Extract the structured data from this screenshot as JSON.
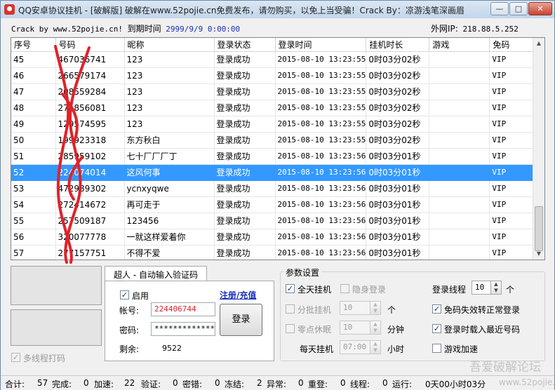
{
  "window": {
    "title": "QQ安卓协议挂机 - [破解版]  破解在www.52pojie.cn免费发布，请勿购买，以免上当受骗！Crack By：凉游浅笔深画眉",
    "controls": {
      "minimize": "—",
      "maximize": "□",
      "close": "✕"
    }
  },
  "info": {
    "crack_by": "Crack by www.52pojie.cn!",
    "expire_label": "到期时间",
    "expire_value": "2999/9/9 0:00:00",
    "ip_label": "外网IP:",
    "ip_value": "218.88.5.252"
  },
  "grid": {
    "columns": [
      "序号",
      "号码",
      "昵称",
      "登录状态",
      "登录时间",
      "挂机时长",
      "游戏",
      "免码"
    ],
    "rows": [
      [
        "45",
        "467036741",
        "123",
        "登录成功",
        "2015-08-10 13:23:55",
        "0时03分02秒",
        "",
        "VIP"
      ],
      [
        "46",
        "266579174",
        "123",
        "登录成功",
        "2015-08-10 13:23:55",
        "0时03分02秒",
        "",
        "VIP"
      ],
      [
        "47",
        "208559284",
        "123",
        "登录成功",
        "2015-08-10 13:23:55",
        "0时03分02秒",
        "",
        "VIP"
      ],
      [
        "48",
        "271856081",
        "123",
        "登录成功",
        "2015-08-10 13:23:55",
        "0时03分02秒",
        "",
        "VIP"
      ],
      [
        "49",
        "129574595",
        "123",
        "登录成功",
        "2015-08-10 13:23:55",
        "0时03分02秒",
        "",
        "VIP"
      ],
      [
        "50",
        "199923318",
        "东方秋白",
        "登录成功",
        "2015-08-10 13:23:55",
        "0时03分02秒",
        "",
        "VIP"
      ],
      [
        "51",
        "285959102",
        "七十厂厂厂丁",
        "登录成功",
        "2015-08-10 13:23:56",
        "0时03分01秒",
        "",
        "VIP"
      ],
      [
        "52",
        "224074014",
        "这风何事",
        "登录成功",
        "2015-08-10 13:23:56",
        "0时03分01秒",
        "",
        "VIP"
      ],
      [
        "53",
        "472989302",
        "ycnxyqwe",
        "登录成功",
        "2015-08-10 13:23:56",
        "0时03分01秒",
        "",
        "VIP"
      ],
      [
        "54",
        "272414672",
        "再可走于",
        "登录成功",
        "2015-08-10 13:23:56",
        "0时03分01秒",
        "",
        "VIP"
      ],
      [
        "55",
        "257509187",
        "123456",
        "登录成功",
        "2015-08-10 13:23:56",
        "0时03分01秒",
        "",
        "VIP"
      ],
      [
        "56",
        "320077778",
        "一就这样爱着你",
        "登录成功",
        "2015-08-10 13:23:56",
        "0时03分01秒",
        "",
        "VIP"
      ],
      [
        "57",
        "277157751",
        "不得不爱",
        "登录成功",
        "2015-08-10 13:23:56",
        "0时03分01秒",
        "",
        "VIP"
      ]
    ],
    "selected_row": 7,
    "scroll_thumb_position": 0.82
  },
  "left": {
    "multi_thread": "多线程打码",
    "multi_thread_checked": true
  },
  "captcha": {
    "tab_title": "超人 - 自动输入验证码",
    "enable": "启用",
    "enable_checked": true,
    "register_link": "注册/充值",
    "account_label": "帐号:",
    "account_value": "224406744",
    "password_label": "密码:",
    "password_value": "*************",
    "remaining_label": "剩余:",
    "remaining_value": "9522",
    "login_button": "登录"
  },
  "params": {
    "title": "参数设置",
    "all_day": "全天挂机",
    "all_day_checked": true,
    "stealth": "隐身登录",
    "stealth_checked": false,
    "threads_label": "登录线程",
    "threads_value": "10",
    "threads_unit": "个",
    "batch": "分批挂机",
    "batch_checked": false,
    "batch_value": "10",
    "batch_unit": "个",
    "free_code": "免码失效转正常登录",
    "free_code_checked": true,
    "zero_sleep": "零点休眠",
    "zero_sleep_checked": false,
    "sleep_value": "10",
    "sleep_unit": "分钟",
    "load_latest": "登录时载入最近号码",
    "load_latest_checked": true,
    "daily_label": "每天挂机",
    "daily_value": "07:00",
    "daily_unit": "小时",
    "game_boost": "游戏加速",
    "game_boost_checked": false,
    "check_mark": "✓"
  },
  "status": {
    "total_label": "合计:",
    "total": "57",
    "done_label": "完成:",
    "done": "0",
    "accel_label": "加速:",
    "accel": "22",
    "verify_label": "验证:",
    "verify": "0",
    "pwd_err_label": "密错:",
    "pwd_err": "0",
    "frozen_label": "冻结:",
    "frozen": "2",
    "abnormal_label": "异常:",
    "abnormal": "0",
    "relogin_label": "重登:",
    "relogin": "0",
    "thread_label": "线程:",
    "thread": "0",
    "running_label": "运行:",
    "running": "0天00小时03分"
  },
  "watermark": {
    "main": "吾爱破解论坛",
    "sub": "www.52pojie.cn"
  },
  "colors": {
    "selection": "#3399ff",
    "link": "#1a2fb8",
    "scribble": "#e0222a"
  }
}
